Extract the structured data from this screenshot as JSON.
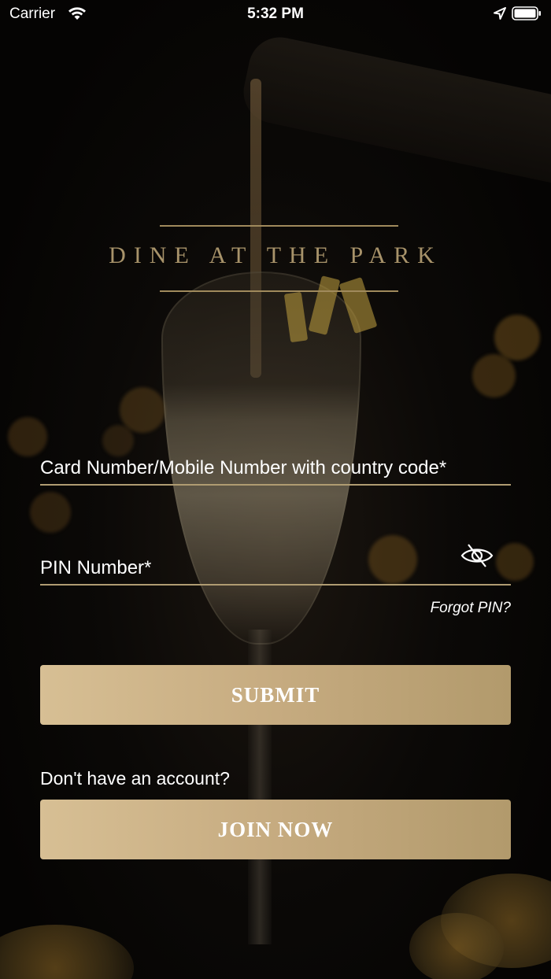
{
  "status_bar": {
    "carrier": "Carrier",
    "time": "5:32 PM"
  },
  "brand": {
    "logo_text": "DINE AT THE PARK"
  },
  "form": {
    "card_field_label": "Card Number/Mobile Number with country code*",
    "pin_field_label": "PIN Number*",
    "forgot_pin": "Forgot PIN?",
    "submit_label": "SUBMIT",
    "no_account_text": "Don't have an account?",
    "join_label": "JOIN NOW"
  },
  "icons": {
    "wifi": "wifi-icon",
    "location": "location-arrow-icon",
    "battery": "battery-icon",
    "password_visibility": "eye-slash-icon"
  },
  "colors": {
    "accent_gold": "#b09c72",
    "button_gold": "#c6ab80",
    "background": "#050403"
  }
}
